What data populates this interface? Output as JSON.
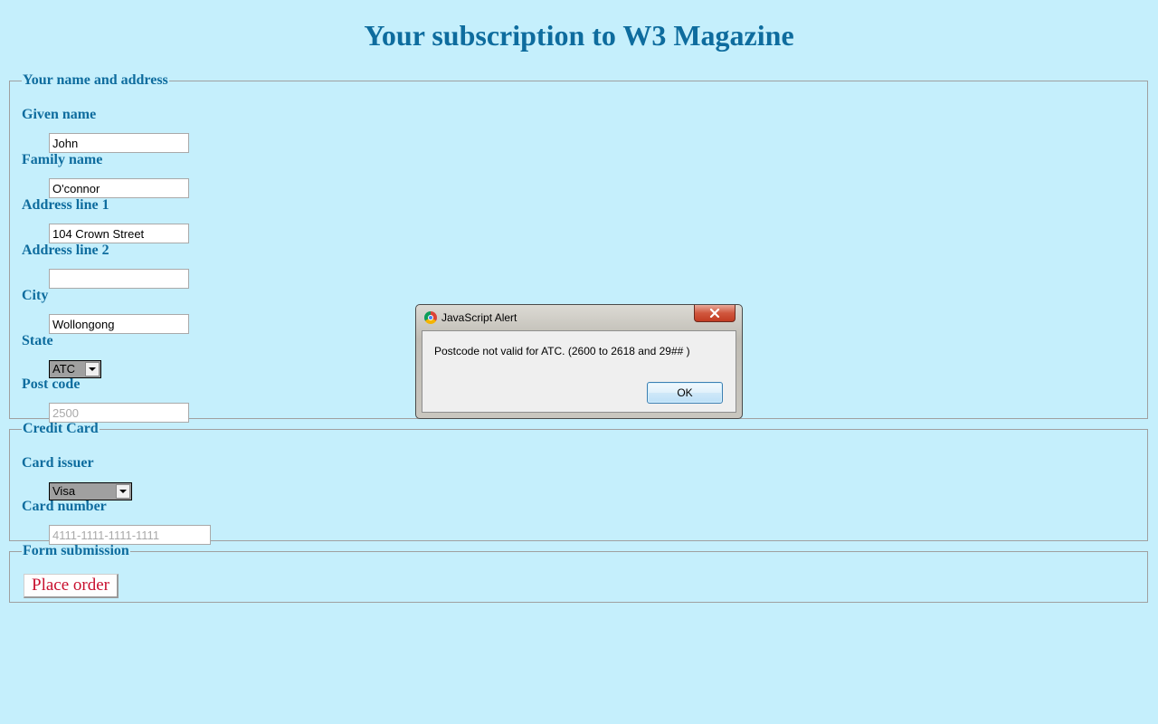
{
  "page": {
    "title": "Your subscription to W3 Magazine"
  },
  "name_address": {
    "legend": "Your name and address",
    "given_name": {
      "label": "Given name",
      "value": "John"
    },
    "family_name": {
      "label": "Family name",
      "value": "O'connor"
    },
    "address_line_1": {
      "label": "Address line 1",
      "value": "104 Crown Street"
    },
    "address_line_2": {
      "label": "Address line 2",
      "value": ""
    },
    "city": {
      "label": "City",
      "value": "Wollongong"
    },
    "state": {
      "label": "State",
      "selected": "ATC"
    },
    "post_code": {
      "label": "Post code",
      "placeholder": "2500",
      "value": ""
    }
  },
  "credit_card": {
    "legend": "Credit Card",
    "card_issuer": {
      "label": "Card issuer",
      "selected": "Visa"
    },
    "card_number": {
      "label": "Card number",
      "placeholder": "4111-1111-1111-1111",
      "value": ""
    }
  },
  "form_submission": {
    "legend": "Form submission",
    "place_order_label": "Place order"
  },
  "alert": {
    "title": "JavaScript Alert",
    "message": "Postcode not valid for ATC. (2600 to 2618 and 29## )",
    "ok_label": "OK",
    "close_icon": "close-icon",
    "app_icon": "chrome-icon"
  },
  "colors": {
    "background": "#c5effc",
    "heading": "#0e6c9e",
    "place_order_text": "#c8102e"
  }
}
